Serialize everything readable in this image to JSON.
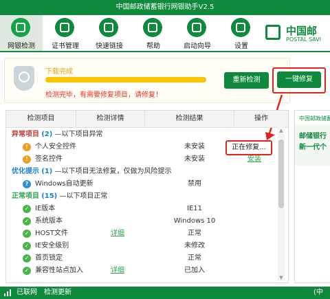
{
  "window": {
    "title": "中国邮政储蓄银行网银助手V2.5"
  },
  "toolbar": {
    "items": [
      {
        "label": "网银检测",
        "icon": "search-icon",
        "active": true
      },
      {
        "label": "证书管理",
        "icon": "book-icon"
      },
      {
        "label": "快速链接",
        "icon": "link-icon"
      },
      {
        "label": "帮助",
        "icon": "help-icon"
      },
      {
        "label": "启动向导",
        "icon": "wizard-icon"
      },
      {
        "label": "设置",
        "icon": "gear-icon"
      }
    ]
  },
  "logo": {
    "cn": "中国邮",
    "en": "POSTAL SAVI"
  },
  "status": {
    "download": "下载完成",
    "progress": 1.0,
    "message": "检测完毕，有需要修复项目，请修复！",
    "recheck_label": "重新检测",
    "fix_label": "一键修复"
  },
  "table": {
    "headers": [
      "检测项目",
      "检测详情",
      "检测结果",
      "操作"
    ],
    "sections": {
      "abnormal": {
        "title": "异常项目",
        "count": "(2)",
        "desc": "—以下项目异常"
      },
      "optimize": {
        "title": "优化提示",
        "count": "(1)",
        "desc": "—以下项目无法修复，仅做为风险提示"
      },
      "normal": {
        "title": "正常项目",
        "count": "(15)",
        "desc": "—以下项目正常"
      }
    },
    "rows": {
      "personal_security": {
        "name": "个人安全控件",
        "result": "未安装",
        "op": "正在修复..."
      },
      "signature": {
        "name": "签名控件",
        "result": "未安装",
        "op": "安装"
      },
      "windows_update": {
        "name": "Windows自动更新",
        "result": "禁用"
      },
      "ie_version": {
        "name": "IE版本",
        "result": "IE11"
      },
      "system_version": {
        "name": "系统版本",
        "result": "Windows 10"
      },
      "host_file": {
        "name": "HOST文件",
        "detail": "详细",
        "result": "正常"
      },
      "ie_security": {
        "name": "IE安全级别",
        "result": "未修改"
      },
      "homepage_lock": {
        "name": "首页锁定",
        "result": "正常"
      },
      "compat": {
        "name": "兼容性站点加入",
        "detail": "详细",
        "result": "已加入"
      }
    }
  },
  "ad": {
    "header": "中国邮政储蓄",
    "line1": "邮储银行",
    "line2": "新一代个"
  },
  "statusbar": {
    "network": "已联网",
    "update": "检测更新",
    "right": "(中"
  },
  "colors": {
    "brand_green": "#0f8a3d",
    "alert_red": "#e1241b",
    "progress_yellow": "#f7c500"
  }
}
